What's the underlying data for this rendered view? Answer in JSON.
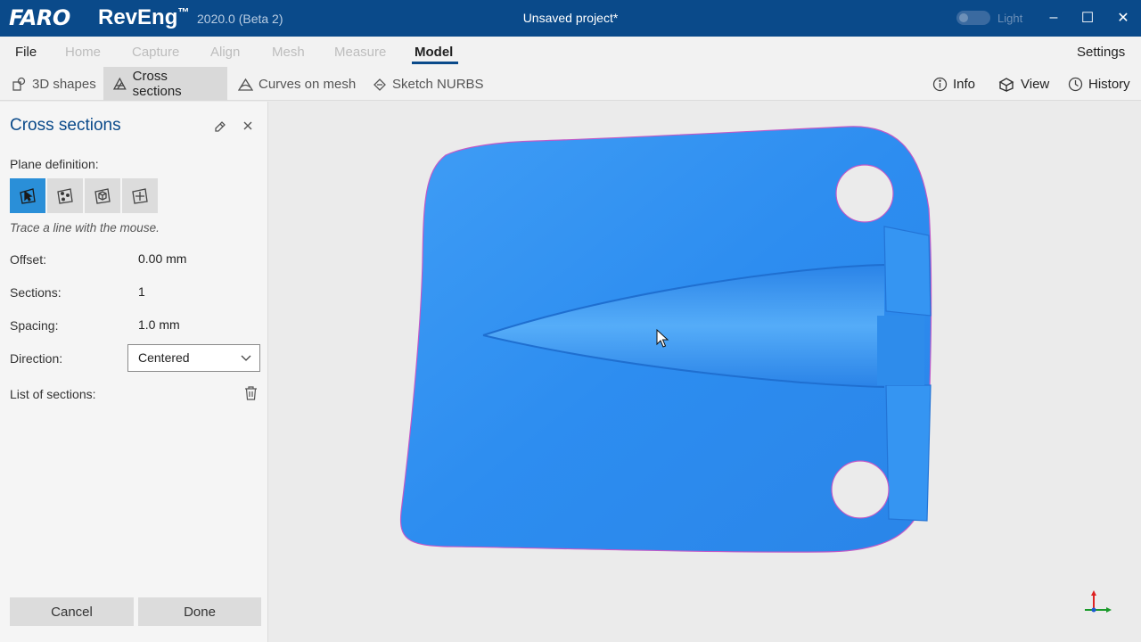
{
  "titlebar": {
    "brand": "FARO",
    "product": "RevEng",
    "trademark": "™",
    "version": "2020.0 (Beta 2)",
    "project_title": "Unsaved project*",
    "theme_label": "Light",
    "window_controls": {
      "minimize": "–",
      "maximize": "☐",
      "close": "✕"
    }
  },
  "menu": {
    "items": [
      {
        "label": "File",
        "state": "enabled"
      },
      {
        "label": "Home",
        "state": "disabled"
      },
      {
        "label": "Capture",
        "state": "disabled"
      },
      {
        "label": "Align",
        "state": "disabled"
      },
      {
        "label": "Mesh",
        "state": "disabled"
      },
      {
        "label": "Measure",
        "state": "disabled"
      },
      {
        "label": "Model",
        "state": "active"
      }
    ],
    "settings": "Settings"
  },
  "toolbar": {
    "left": [
      {
        "label": "3D shapes",
        "icon": "3d-shapes-icon"
      },
      {
        "label": "Cross sections",
        "icon": "cross-sections-icon",
        "active": true
      },
      {
        "label": "Curves on mesh",
        "icon": "curves-on-mesh-icon"
      },
      {
        "label": "Sketch NURBS",
        "icon": "sketch-nurbs-icon"
      }
    ],
    "right": [
      {
        "label": "Info",
        "icon": "info-icon"
      },
      {
        "label": "View",
        "icon": "view-icon"
      },
      {
        "label": "History",
        "icon": "history-icon"
      }
    ]
  },
  "panel": {
    "title": "Cross sections",
    "plane_definition_label": "Plane definition:",
    "plane_buttons": [
      "trace-line-icon",
      "three-points-icon",
      "plane-from-box-icon",
      "plane-custom-icon"
    ],
    "hint": "Trace a line with the mouse.",
    "offset": {
      "label": "Offset:",
      "value": "0.00 mm"
    },
    "sections": {
      "label": "Sections:",
      "value": "1"
    },
    "spacing": {
      "label": "Spacing:",
      "value": "1.0 mm"
    },
    "direction": {
      "label": "Direction:",
      "value": "Centered"
    },
    "list_label": "List of sections:",
    "cancel": "Cancel",
    "done": "Done"
  },
  "colors": {
    "titlebar": "#0a4a8a",
    "mesh": "#2e8ff0",
    "accent": "#2a8fd8"
  }
}
